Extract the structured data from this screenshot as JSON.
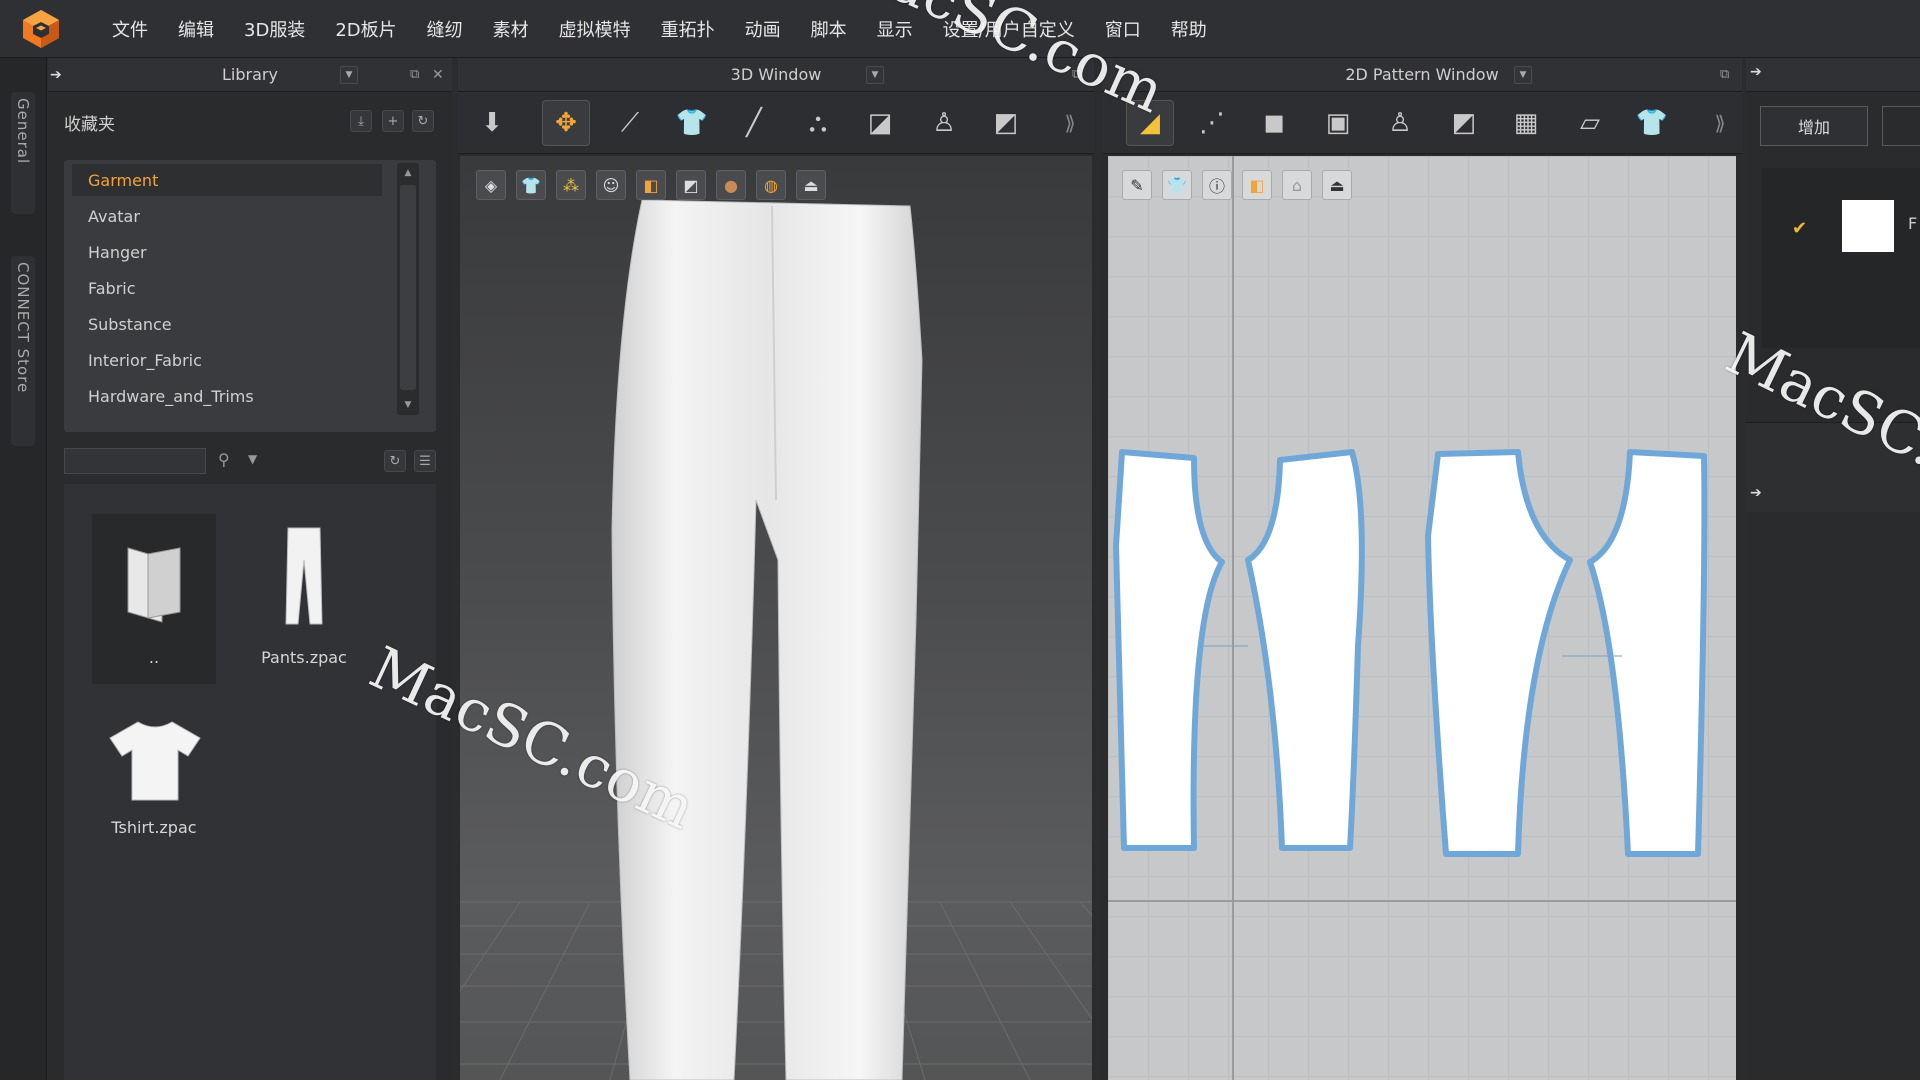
{
  "menu": [
    "文件",
    "编辑",
    "3D服装",
    "2D板片",
    "缝纫",
    "素材",
    "虚拟模特",
    "重拓扑",
    "动画",
    "脚本",
    "显示",
    "设置/用户自定义",
    "窗口",
    "帮助"
  ],
  "side_tabs": [
    "General",
    "CONNECT Store"
  ],
  "library": {
    "title": "Library",
    "favorites_label": "收藏夹",
    "items": [
      "Garment",
      "Avatar",
      "Hanger",
      "Fabric",
      "Substance",
      "Interior_Fabric",
      "Hardware_and_Trims"
    ],
    "selected": "Garment",
    "search_placeholder": "",
    "files": [
      {
        "name": "..",
        "icon": "folder-icon"
      },
      {
        "name": "Pants.zpac",
        "icon": "pants-icon"
      },
      {
        "name": "Tshirt.zpac",
        "icon": "tshirt-icon"
      }
    ]
  },
  "window3d": {
    "title": "3D Window"
  },
  "window2d": {
    "title": "2D Pattern Window"
  },
  "right_panel": {
    "add_label": "增加",
    "partial_label": "F"
  },
  "watermarks": [
    "MacSC.com",
    "MacSC.com",
    "MacSC.co",
    "MacSC.com"
  ],
  "colors": {
    "accent": "#f2a43a",
    "pattern_outline": "#6fa8d8",
    "menubar": "#2f3033"
  }
}
